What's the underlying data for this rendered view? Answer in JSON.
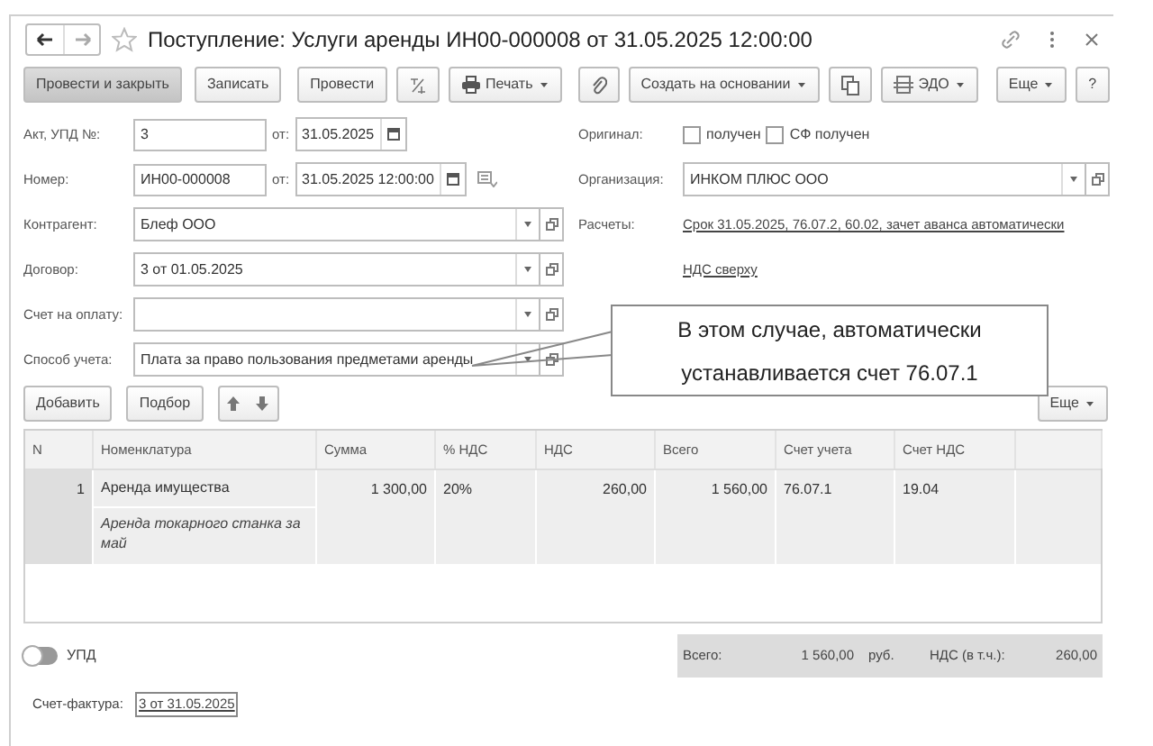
{
  "window": {
    "title": "Поступление: Услуги аренды ИН00-000008 от 31.05.2025 12:00:00"
  },
  "toolbar": {
    "post_close": "Провести и закрыть",
    "save": "Записать",
    "post": "Провести",
    "print": "Печать",
    "create_based_on": "Создать на основании",
    "edo": "ЭДО",
    "more": "Еще",
    "help": "?"
  },
  "header_left": [
    {
      "kind": "numbered",
      "label": "Акт, УПД №:",
      "value": "3",
      "date_label": "от:",
      "date": "31.05.2025"
    },
    {
      "kind": "numbered",
      "label": "Номер:",
      "value": "ИН00-000008",
      "date_label": "от:",
      "date": "31.05.2025 12:00:00"
    },
    {
      "kind": "select",
      "label": "Контрагент:",
      "value": "Блеф ООО"
    },
    {
      "kind": "select",
      "label": "Договор:",
      "value": "3 от 01.05.2025"
    },
    {
      "kind": "select",
      "label": "Счет на оплату:"
    },
    {
      "kind": "select",
      "label": "Способ учета:",
      "value": "Плата за право пользования предметами аренды"
    }
  ],
  "original": {
    "label": "Оригинал:",
    "checkboxes": [
      {
        "label": "получен",
        "checked": false
      },
      {
        "label": "СФ получен",
        "checked": false
      }
    ]
  },
  "organization": {
    "label": "Организация:",
    "value": "ИНКОМ ПЛЮС ООО"
  },
  "settlements": {
    "label": "Расчеты:",
    "links": [
      "Срок 31.05.2025, 76.07.2, 60.02, зачет аванса автоматически",
      "НДС сверху"
    ]
  },
  "table_toolbar": {
    "add": "Добавить",
    "pick": "Подбор",
    "more": "Еще"
  },
  "table": {
    "columns": [
      "N",
      "Номенклатура",
      "Сумма",
      "% НДС",
      "НДС",
      "Всего",
      "Счет учета",
      "Счет НДС"
    ],
    "rows": [
      {
        "n": "1",
        "item": "Аренда имущества",
        "comment": "Аренда токарного станка за май",
        "sum": "1 300,00",
        "vat_rate": "20%",
        "vat": "260,00",
        "total": "1 560,00",
        "account": "76.07.1",
        "vat_account": "19.04"
      }
    ]
  },
  "upd_toggle": {
    "label": "УПД",
    "on": false
  },
  "totals": {
    "total_label": "Всего:",
    "total": "1 560,00",
    "currency": "руб.",
    "vat_label": "НДС (в т.ч.):",
    "vat": "260,00"
  },
  "invoice": {
    "label": "Счет-фактура:",
    "link": "3 от 31.05.2025"
  },
  "callout": {
    "text": "В этом случае, автоматически устанавливается счет 76.07.1"
  }
}
